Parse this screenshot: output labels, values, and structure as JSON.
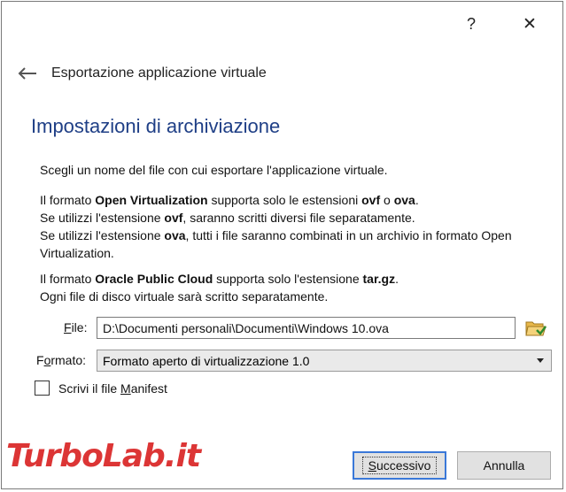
{
  "titlebar": {
    "help_label": "?",
    "close_label": "✕"
  },
  "nav": {
    "back_icon": "arrow-left-icon",
    "title": "Esportazione applicazione virtuale"
  },
  "section": {
    "title": "Impostazioni di archiviazione"
  },
  "intro": "Scegli un nome del file con cui esportare l'applicazione virtuale.",
  "ovf_info": {
    "pre": "Il formato ",
    "format_name": "Open Virtualization",
    "mid": " supporta solo le estensioni ",
    "ext1": "ovf",
    "or": " o ",
    "ext2": "ova",
    "end": ".",
    "line2_pre": "Se utilizzi l'estensione ",
    "line2_ext": "ovf",
    "line2_post": ", saranno scritti diversi file separatamente.",
    "line3_pre": "Se utilizzi l'estensione ",
    "line3_ext": "ova",
    "line3_post": ", tutti i file saranno combinati in un archivio in formato Open Virtualization."
  },
  "opc_info": {
    "pre": "Il formato ",
    "format_name": "Oracle Public Cloud",
    "mid": " supporta solo l'estensione ",
    "ext": "tar.gz",
    "end": ".",
    "line2": "Ogni file di disco virtuale sarà scritto separatamente."
  },
  "file": {
    "label_accel": "F",
    "label_rest": "ile:",
    "value": "D:\\Documenti personali\\Documenti\\Windows 10.ova",
    "browse_icon": "folder-open-icon"
  },
  "format": {
    "label_pre": "F",
    "label_accel": "o",
    "label_rest": "rmato:",
    "selected": "Formato aperto di virtualizzazione 1.0"
  },
  "manifest": {
    "label_pre": "Scrivi il file ",
    "label_accel": "M",
    "label_rest": "anifest",
    "checked": false
  },
  "buttons": {
    "next_accel": "S",
    "next_rest": "uccessivo",
    "cancel": "Annulla"
  },
  "watermark": "TurboLab.it",
  "colors": {
    "section_title": "#1f3f86",
    "default_button_border": "#3a78d8",
    "watermark": "#d92020"
  }
}
